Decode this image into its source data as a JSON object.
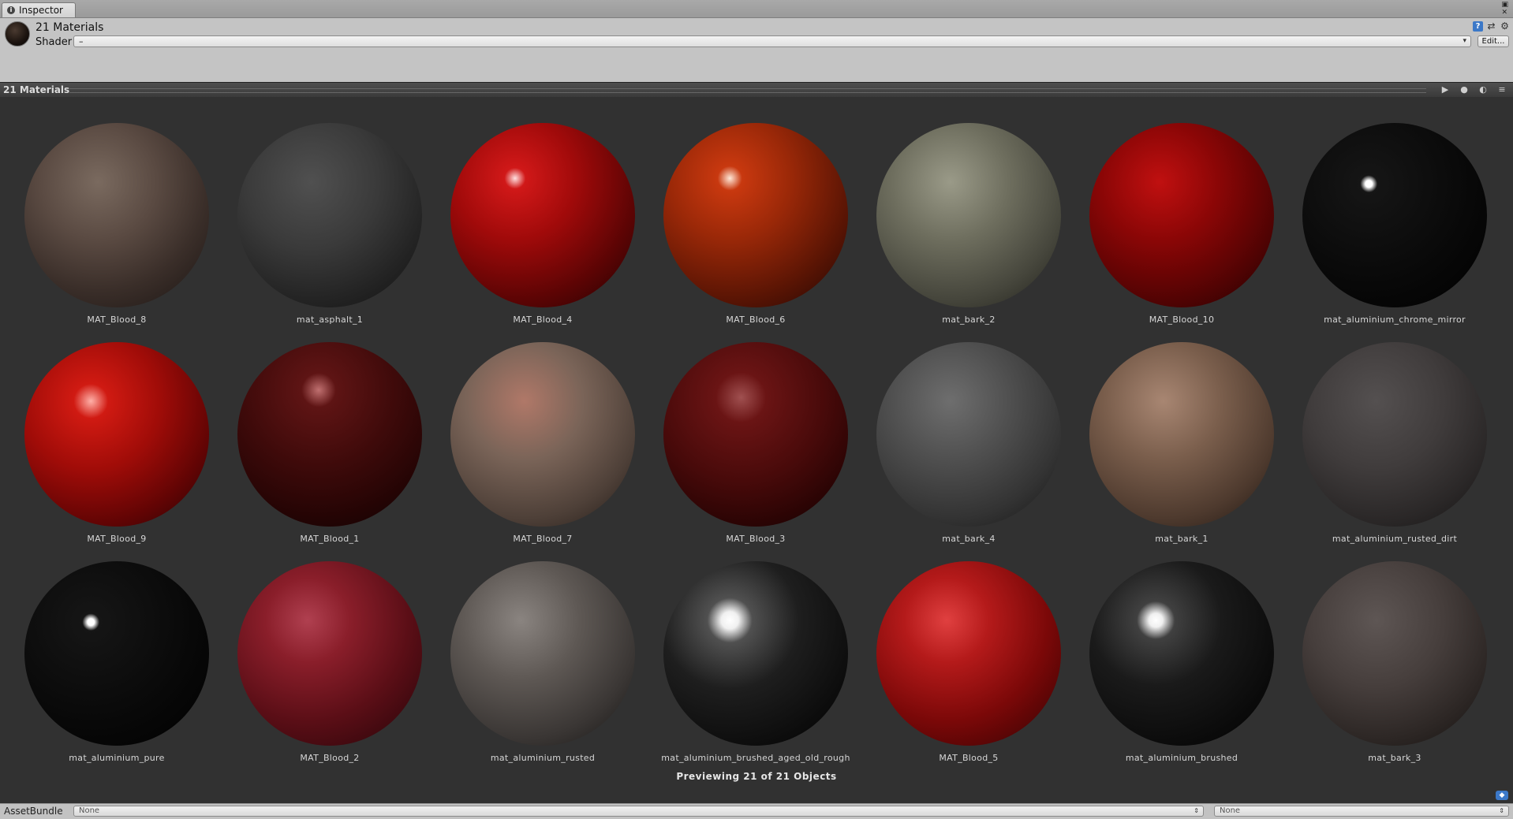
{
  "tab": {
    "title": "Inspector",
    "icon": "info-icon"
  },
  "window_controls": [
    "lock-icon",
    "close-icon"
  ],
  "header": {
    "title": "21 Materials",
    "shader_label": "Shader",
    "shader_value": "–",
    "edit_label": "Edit...",
    "icons": [
      "help-icon",
      "layout-icon",
      "gear-icon"
    ]
  },
  "preview": {
    "title": "21 Materials",
    "buttons": [
      "play-icon",
      "sphere-icon",
      "lights-icon",
      "menu-icon"
    ],
    "status": "Previewing 21 of 21 Objects",
    "materials": [
      {
        "name": "MAT_Blood_8",
        "bg": "radial-gradient(circle at 40% 32%, #7a6a5f 0%, #5a4a42 35%, #3a2e29 65%, #1a1412 100%)"
      },
      {
        "name": "mat_asphalt_1",
        "bg": "radial-gradient(circle at 40% 32%, #505050 0%, #3a3a3a 40%, #242424 70%, #101010 100%)"
      },
      {
        "name": "MAT_Blood_4",
        "bg": "radial-gradient(circle at 35% 30%, #ffe0e0 0%, #d01818 6%, #a00a0a 35%, #5a0404 70%, #1e0101 100%)"
      },
      {
        "name": "MAT_Blood_6",
        "bg": "radial-gradient(circle at 36% 30%, #ffe8d8 0%, #c8380f 7%, #9a2808 35%, #581404 70%, #1e0602 100%)"
      },
      {
        "name": "mat_bark_2",
        "bg": "radial-gradient(circle at 40% 32%, #9a9a88 0%, #6e6e5e 35%, #46463c 70%, #1e1e18 100%)"
      },
      {
        "name": "MAT_Blood_10",
        "bg": "radial-gradient(circle at 38% 32%, #c01010 0%, #8a0606 35%, #520303 70%, #1e0101 100%)"
      },
      {
        "name": "mat_aluminium_chrome_mirror",
        "bg": "radial-gradient(circle at 36% 33%, #ffffff 0%, #ffffff 2%, #151515 5%, #080808 60%, #000000 100%)"
      },
      {
        "name": "MAT_Blood_9",
        "bg": "radial-gradient(circle at 36% 32%, #ffb0a8 0%, #d01a12 10%, #a00c08 40%, #600404 72%, #200101 100%)"
      },
      {
        "name": "MAT_Blood_1",
        "bg": "radial-gradient(circle at 44% 26%, #c07070 0%, #5e1414 10%, #3e0a0a 45%, #240404 75%, #0e0101 100%)"
      },
      {
        "name": "MAT_Blood_7",
        "bg": "radial-gradient(circle at 40% 32%, #b07868 0%, #7a6458 35%, #4e4038 70%, #201814 100%)"
      },
      {
        "name": "MAT_Blood_3",
        "bg": "radial-gradient(circle at 42% 30%, #a05050 0%, #6a1414 15%, #480a0a 50%, #260303 80%, #100101 100%)"
      },
      {
        "name": "mat_bark_4",
        "bg": "radial-gradient(circle at 40% 32%, #6e6e6e 0%, #505050 35%, #333333 70%, #141414 100%)"
      },
      {
        "name": "mat_bark_1",
        "bg": "radial-gradient(circle at 40% 32%, #a88672 0%, #7a5e4c 35%, #4e3a2e 70%, #1e1510 100%)"
      },
      {
        "name": "mat_aluminium_rusted_dirt",
        "bg": "radial-gradient(circle at 40% 32%, #545050 0%, #403c3c 40%, #2a2727 72%, #121111 100%)"
      },
      {
        "name": "mat_aluminium_pure",
        "bg": "radial-gradient(circle at 36% 33%, #ffffff 0%, #ffffff 2%, #151515 5%, #080808 60%, #000000 100%)"
      },
      {
        "name": "MAT_Blood_2",
        "bg": "radial-gradient(circle at 38% 32%, #b04050 0%, #8a1e2a 25%, #5a0e16 60%, #240408 100%)"
      },
      {
        "name": "mat_aluminium_rusted",
        "bg": "radial-gradient(circle at 38% 32%, #8a8480 0%, #5e5854 35%, #3a3634 70%, #141312 100%)"
      },
      {
        "name": "mat_aluminium_brushed_aged_old_rough",
        "bg": "radial-gradient(circle at 36% 32%, #ffffff 0%, #f0f0f0 5%, #505050 13%, #1e1e1e 40%, #0c0c0c 75%, #000000 100%)"
      },
      {
        "name": "MAT_Blood_5",
        "bg": "radial-gradient(circle at 38% 32%, #e04040 0%, #b41a1a 25%, #7a0808 60%, #2e0202 100%)"
      },
      {
        "name": "mat_aluminium_brushed",
        "bg": "radial-gradient(circle at 36% 32%, #ffffff 0%, #f0f0f0 4%, #404040 11%, #1a1a1a 38%, #0a0a0a 75%, #000000 100%)"
      },
      {
        "name": "mat_bark_3",
        "bg": "radial-gradient(circle at 40% 32%, #5e5654 0%, #463e3c 40%, #2c2624 72%, #120f0e 100%)"
      }
    ]
  },
  "asset_bundle": {
    "label": "AssetBundle",
    "bundle_value": "None",
    "variant_value": "None"
  }
}
